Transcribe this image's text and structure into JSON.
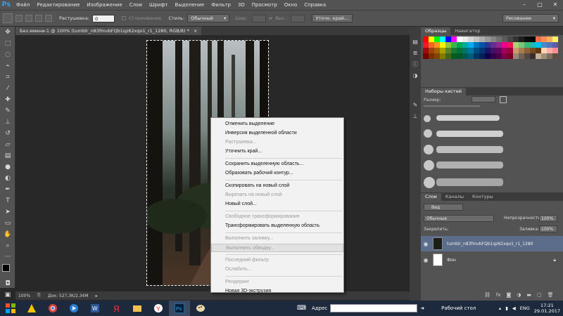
{
  "menubar": {
    "logo": "Ps",
    "items": [
      "Файл",
      "Редактирование",
      "Изображение",
      "Слои",
      "Шрифт",
      "Выделение",
      "Фильтр",
      "3D",
      "Просмотр",
      "Окно",
      "Справка"
    ]
  },
  "options": {
    "feather_label": "Растушевка:",
    "feather_value": "0 пикс.",
    "antialias_label": "Сглаживание",
    "style_label": "Стиль:",
    "style_value": "Обычный",
    "width_label": "Шир.:",
    "height_label": "Выс.:",
    "refine_button": "Уточн. край...",
    "workspace": "Рисование"
  },
  "document": {
    "tab_title": "Без имени-1 @ 100% (tumblr_n83fmvbFQb1qz62xqo1_r1_1280, RGB/8) *",
    "tab_close": "×"
  },
  "status": {
    "zoom": "100%",
    "doc_info": "Док: 527,3K/2,34M"
  },
  "panels": {
    "swatches_tab": "Образцы",
    "navigator_tab": "Навигатор",
    "brushes_tab": "Наборы кистей",
    "size_label": "Размер:",
    "layers_tab": "Слои",
    "channels_tab": "Каналы",
    "paths_tab": "Контуры",
    "kind_label": "Вид",
    "blend_mode": "Обычные",
    "opacity_label": "Непрозрачность:",
    "opacity_value": "100%",
    "lock_label": "Закрепить:",
    "fill_label": "Заливка:",
    "fill_value": "100%",
    "layers": [
      {
        "name": "tumblr_n83fmvbFQb1qz62xqo1_r1_1280",
        "selected": true
      },
      {
        "name": "Фон",
        "selected": false
      }
    ]
  },
  "context_menu": {
    "items": [
      {
        "label": "Отменить выделение",
        "disabled": false
      },
      {
        "label": "Инверсия выделенной области",
        "disabled": false
      },
      {
        "label": "Растушевка...",
        "disabled": true
      },
      {
        "label": "Уточнить край...",
        "disabled": false
      },
      {
        "label": "Сохранить выделенную область...",
        "disabled": false
      },
      {
        "label": "Образовать рабочий контур...",
        "disabled": false
      },
      {
        "label": "Скопировать на новый слой",
        "disabled": false
      },
      {
        "label": "Вырезать на новый слой",
        "disabled": true
      },
      {
        "label": "Новый слой...",
        "disabled": false
      },
      {
        "label": "Свободное трансформирование",
        "disabled": true
      },
      {
        "label": "Трансформировать выделенную область",
        "disabled": false
      },
      {
        "label": "Выполнить заливку...",
        "disabled": true
      },
      {
        "label": "Выполнить обводку...",
        "disabled": true,
        "highlighted": true
      },
      {
        "label": "Последний фильтр",
        "disabled": true
      },
      {
        "label": "Ослабить...",
        "disabled": true
      },
      {
        "label": "Рендеринг",
        "disabled": true
      },
      {
        "label": "Новая 3D-экструзия",
        "disabled": false
      }
    ]
  },
  "taskbar": {
    "address_label": "Адрес",
    "desktop_label": "Рабочий стол",
    "lang": "ENG",
    "time": "17:21",
    "date": "29.01.2017"
  },
  "colors": {
    "accent": "#31a8ff",
    "layer_selected": "#5b6d8a"
  }
}
